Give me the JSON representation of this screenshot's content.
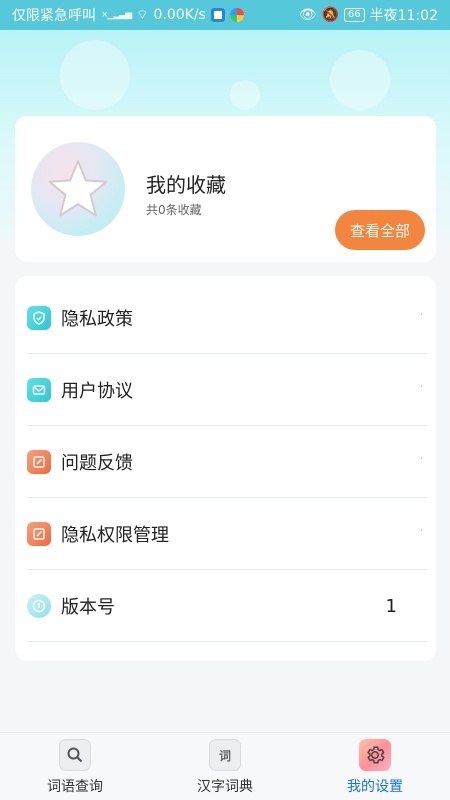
{
  "status_bar": {
    "carrier": "仅限紧急呼叫",
    "speed": "0.00K/s",
    "battery": "66",
    "time": "半夜11:02"
  },
  "favorites": {
    "title": "我的收藏",
    "count": "共0条收藏",
    "view_all_label": "查看全部"
  },
  "menu": {
    "items": [
      {
        "label": "隐私政策",
        "icon": "shield-icon",
        "mark": "·"
      },
      {
        "label": "用户协议",
        "icon": "mail-icon",
        "mark": "·"
      },
      {
        "label": "问题反馈",
        "icon": "edit-icon",
        "mark": "·"
      },
      {
        "label": "隐私权限管理",
        "icon": "edit-icon",
        "mark": "·"
      },
      {
        "label": "版本号",
        "icon": "info-icon",
        "value": "1"
      }
    ]
  },
  "bottom_nav": {
    "items": [
      {
        "label": "词语查询",
        "icon": "search-icon"
      },
      {
        "label": "汉字词典",
        "icon": "dictionary-icon",
        "glyph": "词"
      },
      {
        "label": "我的设置",
        "icon": "gear-icon"
      }
    ],
    "active_index": 2
  },
  "colors": {
    "accent_orange": "#f4853e",
    "active_tab": "#1673e6",
    "status_bar": "#55c8da"
  }
}
